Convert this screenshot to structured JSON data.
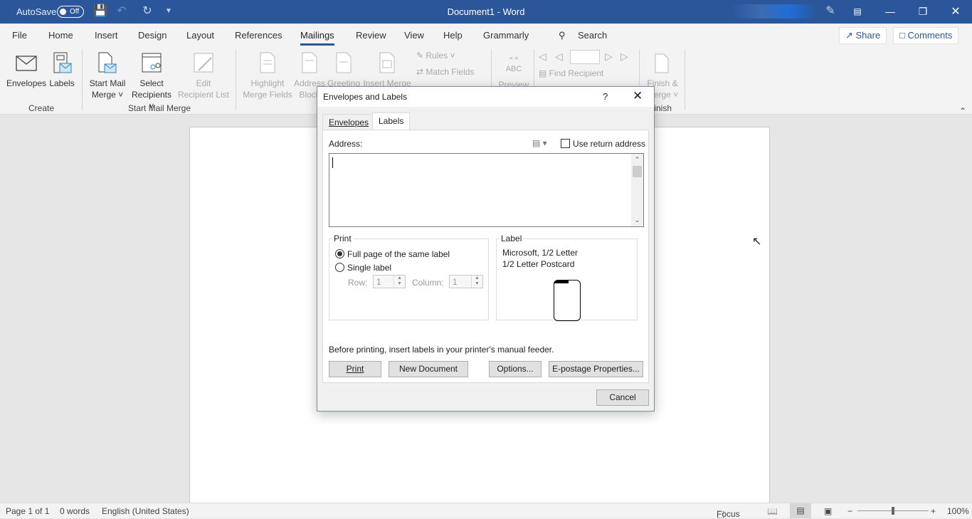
{
  "titlebar": {
    "autosave_label": "AutoSave",
    "autosave_state": "Off",
    "document_title": "Document1  -  Word",
    "icons": [
      "save-icon",
      "undo-icon",
      "redo-icon",
      "customize-quick-access-icon",
      "designer-icon",
      "ribbon-display-options-icon",
      "minimize-icon",
      "restore-icon",
      "close-icon"
    ]
  },
  "tabs": {
    "items": [
      "File",
      "Home",
      "Insert",
      "Design",
      "Layout",
      "References",
      "Mailings",
      "Review",
      "View",
      "Help",
      "Grammarly"
    ],
    "active": "Mailings",
    "search_label": "Search",
    "share_label": "Share",
    "comments_label": "Comments"
  },
  "ribbon": {
    "groups": {
      "create": "Create",
      "start_mail_merge": "Start Mail Merge",
      "finish": "Finish"
    },
    "buttons": {
      "envelopes": "Envelopes",
      "labels": "Labels",
      "start_mail_merge_1": "Start Mail",
      "start_mail_merge_2": "Merge",
      "select_recipients_1": "Select",
      "select_recipients_2": "Recipients",
      "edit_recipient_list_1": "Edit",
      "edit_recipient_list_2": "Recipient List",
      "highlight_1": "Highlight",
      "highlight_2": "Merge Fields",
      "address_block_1": "Address",
      "address_block_2": "Block",
      "greeting_line": "Greeting",
      "insert_merge": "Insert Merge",
      "rules": "Rules",
      "match_fields": "Match Fields",
      "preview_abc": "ABC",
      "preview": "Preview",
      "find_recipient": "Find Recipient",
      "finish_1": "Finish &",
      "finish_2": "Merge"
    },
    "record_value": ""
  },
  "dialog": {
    "title": "Envelopes and Labels",
    "help": "?",
    "tabs": [
      "Envelopes",
      "Labels"
    ],
    "active_tab": "Labels",
    "address_label": "Address:",
    "address_value": "",
    "use_return_address_label": "Use return address",
    "use_return_address_checked": false,
    "print_group": {
      "legend": "Print",
      "options": [
        "Full page of the same label",
        "Single label"
      ],
      "selected": "Full page of the same label",
      "row_label": "Row:",
      "row_value": "1",
      "column_label": "Column:",
      "column_value": "1"
    },
    "label_group": {
      "legend": "Label",
      "vendor": "Microsoft, 1/2 Letter",
      "product": "1/2 Letter Postcard"
    },
    "hint": "Before printing, insert labels in your printer's manual feeder.",
    "buttons": {
      "print": "Print",
      "new_document": "New Document",
      "options": "Options...",
      "epostage": "E-postage Properties...",
      "cancel": "Cancel"
    }
  },
  "statusbar": {
    "page": "Page 1 of 1",
    "words": "0 words",
    "language": "English (United States)",
    "focus": "Focus",
    "zoom": "100%",
    "zoom_fraction": 0.5
  }
}
